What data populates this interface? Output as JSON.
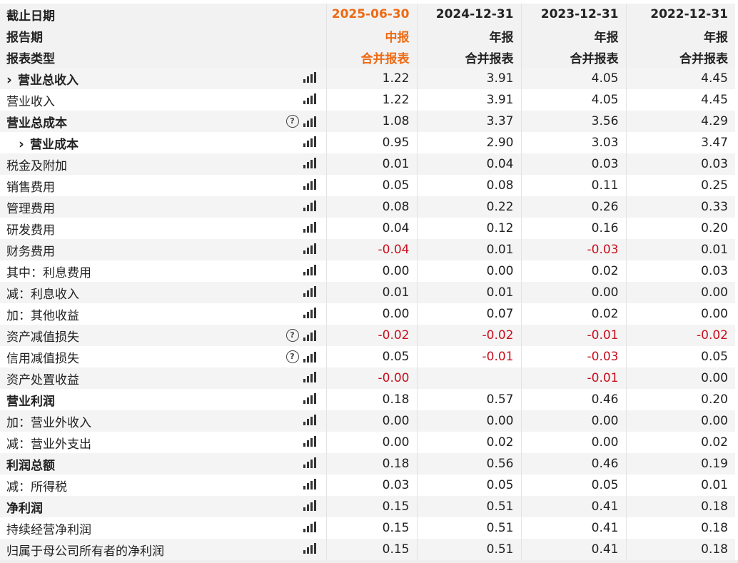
{
  "header_rows": [
    {
      "label": "截止日期",
      "values": [
        "2025-06-30",
        "2024-12-31",
        "2023-12-31",
        "2022-12-31"
      ]
    },
    {
      "label": "报告期",
      "values": [
        "中报",
        "年报",
        "年报",
        "年报"
      ]
    },
    {
      "label": "报表类型",
      "values": [
        "合并报表",
        "合并报表",
        "合并报表",
        "合并报表"
      ]
    }
  ],
  "icons": {
    "chart": "bar-chart-icon",
    "help": "question-circle-icon",
    "expand": "chevron-right-icon"
  },
  "colors": {
    "highlight": "#ee6a12",
    "negative": "#c8101e"
  },
  "rows": [
    {
      "label": "营业总收入",
      "values": [
        "1.22",
        "3.91",
        "4.05",
        "4.45"
      ]
    },
    {
      "label": "营业收入",
      "values": [
        "1.22",
        "3.91",
        "4.05",
        "4.45"
      ]
    },
    {
      "label": "营业总成本",
      "values": [
        "1.08",
        "3.37",
        "3.56",
        "4.29"
      ]
    },
    {
      "label": "营业成本",
      "values": [
        "0.95",
        "2.90",
        "3.03",
        "3.47"
      ]
    },
    {
      "label": "税金及附加",
      "values": [
        "0.01",
        "0.04",
        "0.03",
        "0.03"
      ]
    },
    {
      "label": "销售费用",
      "values": [
        "0.05",
        "0.08",
        "0.11",
        "0.25"
      ]
    },
    {
      "label": "管理费用",
      "values": [
        "0.08",
        "0.22",
        "0.26",
        "0.33"
      ]
    },
    {
      "label": "研发费用",
      "values": [
        "0.04",
        "0.12",
        "0.16",
        "0.20"
      ]
    },
    {
      "label": "财务费用",
      "values": [
        "-0.04",
        "0.01",
        "-0.03",
        "0.01"
      ]
    },
    {
      "label": "其中：利息费用",
      "values": [
        "0.00",
        "0.00",
        "0.02",
        "0.03"
      ]
    },
    {
      "label": "减：利息收入",
      "values": [
        "0.01",
        "0.01",
        "0.00",
        "0.00"
      ]
    },
    {
      "label": "加：其他收益",
      "values": [
        "0.00",
        "0.07",
        "0.02",
        "0.00"
      ]
    },
    {
      "label": "资产减值损失",
      "values": [
        "-0.02",
        "-0.02",
        "-0.01",
        "-0.02"
      ]
    },
    {
      "label": "信用减值损失",
      "values": [
        "0.05",
        "-0.01",
        "-0.03",
        "0.05"
      ]
    },
    {
      "label": "资产处置收益",
      "values": [
        "-0.00",
        "",
        "-0.01",
        "0.00"
      ]
    },
    {
      "label": "营业利润",
      "values": [
        "0.18",
        "0.57",
        "0.46",
        "0.20"
      ]
    },
    {
      "label": "加：营业外收入",
      "values": [
        "0.00",
        "0.00",
        "0.00",
        "0.00"
      ]
    },
    {
      "label": "减：营业外支出",
      "values": [
        "0.00",
        "0.02",
        "0.00",
        "0.02"
      ]
    },
    {
      "label": "利润总额",
      "values": [
        "0.18",
        "0.56",
        "0.46",
        "0.19"
      ]
    },
    {
      "label": "减：所得税",
      "values": [
        "0.03",
        "0.05",
        "0.05",
        "0.01"
      ]
    },
    {
      "label": "净利润",
      "values": [
        "0.15",
        "0.51",
        "0.41",
        "0.18"
      ]
    },
    {
      "label": "持续经营净利润",
      "values": [
        "0.15",
        "0.51",
        "0.41",
        "0.18"
      ]
    },
    {
      "label": "归属于母公司所有者的净利润",
      "values": [
        "0.15",
        "0.51",
        "0.41",
        "0.18"
      ]
    }
  ]
}
